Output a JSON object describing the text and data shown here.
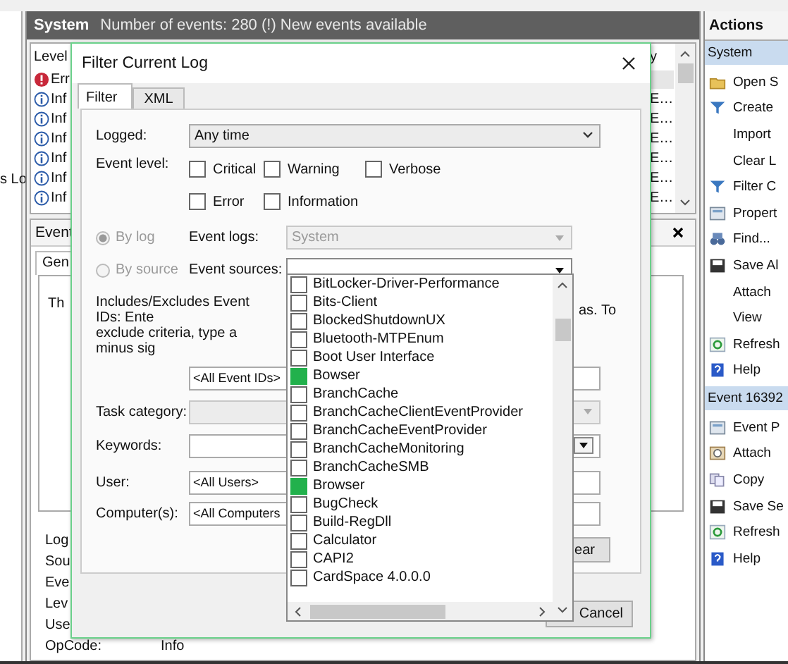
{
  "sidebar": {
    "text": "s Lo"
  },
  "header": {
    "title": "System",
    "info": "Number of events: 280 (!) New events available"
  },
  "events": {
    "columns": [
      "Level",
      "y"
    ],
    "rows": [
      {
        "kind": "error",
        "level": "Err"
      },
      {
        "kind": "info",
        "level": "Inf",
        "column_2": "E…"
      },
      {
        "kind": "info",
        "level": "Inf",
        "column_2": "E…"
      },
      {
        "kind": "info",
        "level": "Inf",
        "column_2": "E…"
      },
      {
        "kind": "info",
        "level": "Inf",
        "column_2": "E…"
      },
      {
        "kind": "info",
        "level": "Inf",
        "column_2": "E…"
      },
      {
        "kind": "info",
        "level": "Inf",
        "column_2": "E…"
      }
    ]
  },
  "details": {
    "title": "Event",
    "tab": "Gen",
    "text": "Th",
    "labels": [
      "Log",
      "Sou",
      "Eve",
      "Lev",
      "Use"
    ],
    "opcode": {
      "label": "OpCode:",
      "value": "Info"
    }
  },
  "actions": {
    "title": "Actions",
    "sections": [
      {
        "title": "System",
        "items": [
          "Open S",
          "Create",
          "Import",
          "Clear L",
          "Filter C",
          "Propert",
          "Find...",
          "Save Al",
          "Attach",
          "View",
          "Refresh",
          "Help"
        ]
      },
      {
        "title": "Event 16392",
        "items": [
          "Event P",
          "Attach",
          "Copy",
          "Save Se",
          "Refresh",
          "Help"
        ]
      }
    ]
  },
  "dialog": {
    "title": "Filter Current Log",
    "tabs": [
      {
        "label": "Filter",
        "selected": true
      },
      {
        "label": "XML",
        "selected": false
      }
    ],
    "logged": {
      "label": "Logged:",
      "value": "Any time"
    },
    "event_level": {
      "label": "Event level:",
      "options": [
        {
          "label": "Critical",
          "checked": false
        },
        {
          "label": "Warning",
          "checked": false
        },
        {
          "label": "Verbose",
          "checked": false
        },
        {
          "label": "Error",
          "checked": false
        },
        {
          "label": "Information",
          "checked": false
        }
      ]
    },
    "scope": [
      {
        "label": "By log",
        "selected": true,
        "disabled": true
      },
      {
        "label": "By source",
        "selected": false,
        "disabled": true
      }
    ],
    "event_logs": {
      "label": "Event logs:",
      "value": "System",
      "disabled": true
    },
    "event_sources": {
      "label": "Event sources:",
      "items": [
        {
          "label": "BitLocker-Driver-Performance",
          "checked": false
        },
        {
          "label": "Bits-Client",
          "checked": false
        },
        {
          "label": "BlockedShutdownUX",
          "checked": false
        },
        {
          "label": "Bluetooth-MTPEnum",
          "checked": false
        },
        {
          "label": "Boot User Interface",
          "checked": false
        },
        {
          "label": "Bowser",
          "checked": true
        },
        {
          "label": "BranchCache",
          "checked": false
        },
        {
          "label": "BranchCacheClientEventProvider",
          "checked": false
        },
        {
          "label": "BranchCacheEventProvider",
          "checked": false
        },
        {
          "label": "BranchCacheMonitoring",
          "checked": false
        },
        {
          "label": "BranchCacheSMB",
          "checked": false
        },
        {
          "label": "Browser",
          "checked": true
        },
        {
          "label": "BugCheck",
          "checked": false
        },
        {
          "label": "Build-RegDll",
          "checked": false
        },
        {
          "label": "Calculator",
          "checked": false
        },
        {
          "label": "CAPI2",
          "checked": false
        },
        {
          "label": "CardSpace 4.0.0.0",
          "checked": false
        }
      ]
    },
    "ids_help": {
      "line_1": "Includes/Excludes Event IDs: Ente",
      "line_2": "exclude criteria, type a minus sig",
      "line_1_end": "as. To"
    },
    "event_ids": {
      "value": "<All Event IDs>"
    },
    "task_category": {
      "label": "Task category:",
      "disabled": true
    },
    "keywords": {
      "label": "Keywords:"
    },
    "user": {
      "label": "User:",
      "value": "<All Users>"
    },
    "computer": {
      "label": "Computer(s):",
      "value": "<All Computers"
    },
    "clear_button": "ear",
    "cancel_button": "Cancel"
  }
}
